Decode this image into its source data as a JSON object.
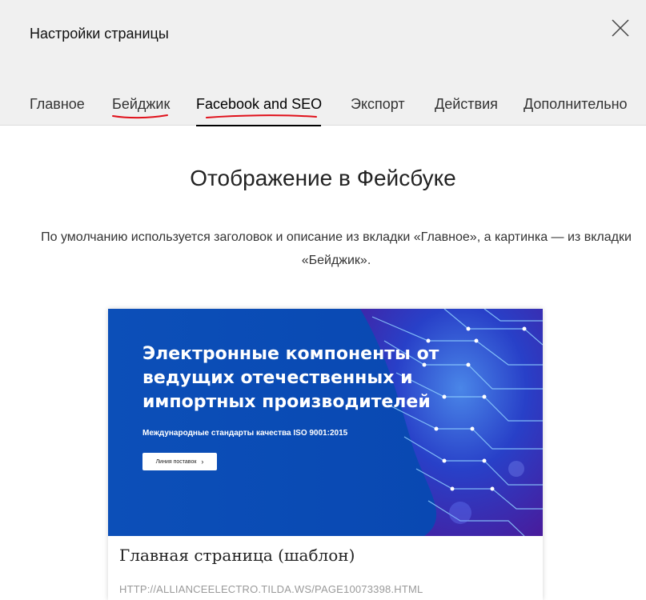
{
  "header": {
    "title": "Настройки страницы",
    "close_icon": "close-icon"
  },
  "tabs": [
    {
      "label": "Главное",
      "active": false
    },
    {
      "label": "Бейджик",
      "active": false
    },
    {
      "label": "Facebook and SEO",
      "active": true
    },
    {
      "label": "Экспорт",
      "active": false
    },
    {
      "label": "Действия",
      "active": false
    },
    {
      "label": "Дополнительно",
      "active": false
    }
  ],
  "annotation_color": "#e0101a",
  "main": {
    "heading": "Отображение в Фейсбуке",
    "description": "По умолчанию используется заголовок и описание из вкладки «Главное», а картинка — из вкладки «Бейджик»."
  },
  "preview": {
    "banner_title": "Электронные компоненты от ведущих отечественных и импортных производителей",
    "banner_subtitle": "Международные стандарты качества ISO 9001:2015",
    "banner_button": "Линия поставок",
    "banner_button_icon": "chevron-right-icon",
    "banner_bg_color": "#0a4ab5",
    "title": "Главная страница (шаблон)",
    "url": "HTTP://ALLIANCEELECTRO.TILDA.WS/PAGE10073398.HTML"
  }
}
